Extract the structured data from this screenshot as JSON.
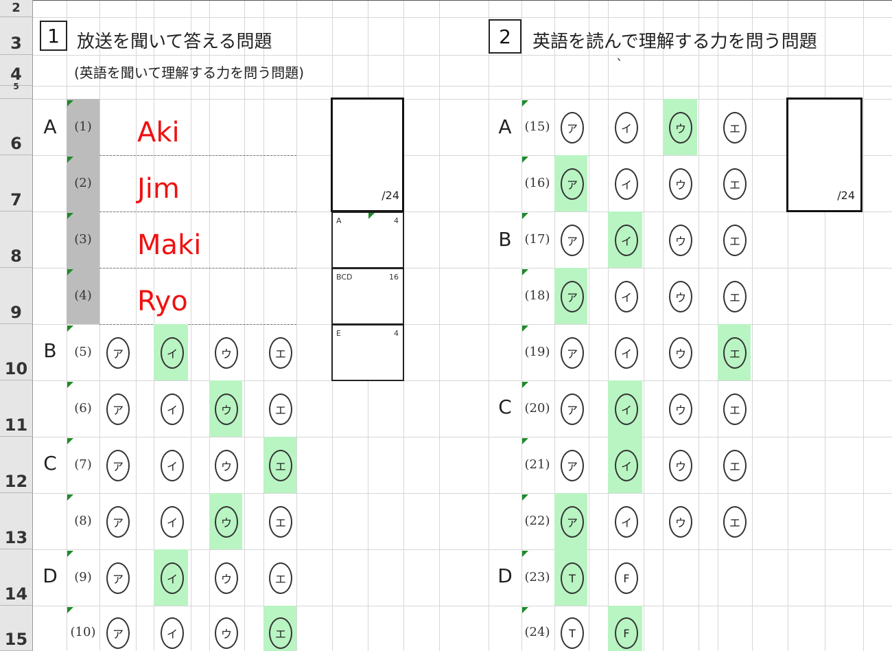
{
  "row_numbers": [
    "2",
    "3",
    "4",
    "5",
    "6",
    "7",
    "8",
    "9",
    "10",
    "11",
    "12",
    "13",
    "14",
    "15"
  ],
  "section1": {
    "number": "1",
    "title": "放送を聞いて答える問題",
    "subtitle": "(英語を聞いて理解する力を問う問題)",
    "names": [
      {
        "label": "(1)",
        "name": "Aki"
      },
      {
        "label": "(2)",
        "name": "Jim"
      },
      {
        "label": "(3)",
        "name": "Maki"
      },
      {
        "label": "(4)",
        "name": "Ryo"
      }
    ],
    "group_letters": [
      "A",
      "B",
      "C",
      "D"
    ],
    "score_total": "/24",
    "breakdown": [
      {
        "label": "A",
        "value": "4"
      },
      {
        "label": "BCD",
        "value": "16"
      },
      {
        "label": "E",
        "value": "4"
      }
    ],
    "choice_rows": [
      {
        "label": "(5)",
        "choices": [
          "ア",
          "イ",
          "ウ",
          "エ"
        ],
        "selected": 1
      },
      {
        "label": "(6)",
        "choices": [
          "ア",
          "イ",
          "ウ",
          "エ"
        ],
        "selected": 2
      },
      {
        "label": "(7)",
        "choices": [
          "ア",
          "イ",
          "ウ",
          "エ"
        ],
        "selected": 3
      },
      {
        "label": "(8)",
        "choices": [
          "ア",
          "イ",
          "ウ",
          "エ"
        ],
        "selected": 2
      },
      {
        "label": "(9)",
        "choices": [
          "ア",
          "イ",
          "ウ",
          "エ"
        ],
        "selected": 1
      },
      {
        "label": "(10)",
        "choices": [
          "ア",
          "イ",
          "ウ",
          "エ"
        ],
        "selected": 3
      }
    ]
  },
  "section2": {
    "number": "2",
    "title": "英語を読んで理解する力を問う問題",
    "stray_mark": "`",
    "group_letters": [
      "A",
      "B",
      "C",
      "D"
    ],
    "score_total": "/24",
    "choice_rows": [
      {
        "label": "(15)",
        "choices": [
          "ア",
          "イ",
          "ウ",
          "エ"
        ],
        "selected": 2
      },
      {
        "label": "(16)",
        "choices": [
          "ア",
          "イ",
          "ウ",
          "エ"
        ],
        "selected": 0
      },
      {
        "label": "(17)",
        "choices": [
          "ア",
          "イ",
          "ウ",
          "エ"
        ],
        "selected": 1
      },
      {
        "label": "(18)",
        "choices": [
          "ア",
          "イ",
          "ウ",
          "エ"
        ],
        "selected": 0
      },
      {
        "label": "(19)",
        "choices": [
          "ア",
          "イ",
          "ウ",
          "エ"
        ],
        "selected": 3
      },
      {
        "label": "(20)",
        "choices": [
          "ア",
          "イ",
          "ウ",
          "エ"
        ],
        "selected": 1
      },
      {
        "label": "(21)",
        "choices": [
          "ア",
          "イ",
          "ウ",
          "エ"
        ],
        "selected": 1
      },
      {
        "label": "(22)",
        "choices": [
          "ア",
          "イ",
          "ウ",
          "エ"
        ],
        "selected": 0
      },
      {
        "label": "(23)",
        "choices": [
          "T",
          "F"
        ],
        "selected": 0
      },
      {
        "label": "(24)",
        "choices": [
          "T",
          "F"
        ],
        "selected": 1
      }
    ]
  },
  "colors": {
    "highlight": "#b9f4c3",
    "name_text": "#ee1111",
    "marker": "#1f8a2b",
    "gray_column": "#bcbcbc"
  }
}
